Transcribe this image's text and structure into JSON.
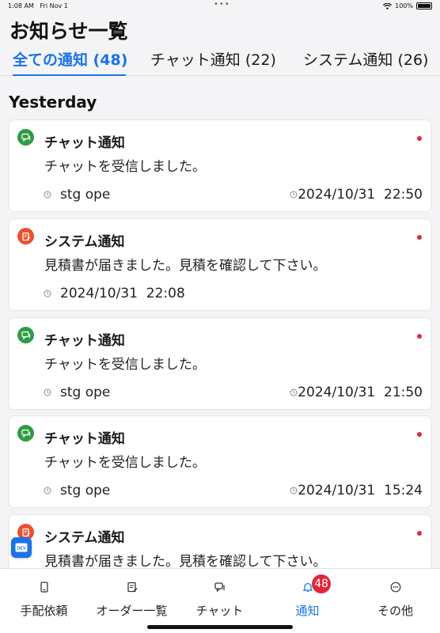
{
  "status_bar": {
    "time": "1:08 AM",
    "date": "Fri Nov 1",
    "battery": "100%"
  },
  "page": {
    "title": "お知らせ一覧"
  },
  "tabs": [
    {
      "label": "全ての通知 (48)",
      "active": true
    },
    {
      "label": "チャット通知 (22)",
      "active": false
    },
    {
      "label": "システム通知 (26)",
      "active": false
    }
  ],
  "section": {
    "header": "Yesterday"
  },
  "notifications": [
    {
      "type": "chat",
      "icon": "chat-bubble-icon",
      "title": "チャット通知",
      "message": "チャットを受信しました。",
      "sender": "stg ope",
      "datetime": "2024/10/31  22:50",
      "unread": true
    },
    {
      "type": "system",
      "icon": "document-edit-icon",
      "title": "システム通知",
      "message": "見積書が届きました。見積を確認して下さい。",
      "sender": "",
      "datetime": "2024/10/31  22:08",
      "unread": true
    },
    {
      "type": "chat",
      "icon": "chat-bubble-icon",
      "title": "チャット通知",
      "message": "チャットを受信しました。",
      "sender": "stg ope",
      "datetime": "2024/10/31  21:50",
      "unread": true
    },
    {
      "type": "chat",
      "icon": "chat-bubble-icon",
      "title": "チャット通知",
      "message": "チャットを受信しました。",
      "sender": "stg ope",
      "datetime": "2024/10/31  15:24",
      "unread": true
    },
    {
      "type": "system",
      "icon": "document-edit-icon",
      "title": "システム通知",
      "message": "見積書が届きました。見積を確認して下さい。",
      "sender": "",
      "datetime": "",
      "unread": true
    }
  ],
  "fab": {
    "label": "DEV"
  },
  "bottom_nav": [
    {
      "label": "手配依頼",
      "icon": "phone-request-icon",
      "active": false
    },
    {
      "label": "オーダー一覧",
      "icon": "order-list-icon",
      "active": false
    },
    {
      "label": "チャット",
      "icon": "chat-icon",
      "active": false
    },
    {
      "label": "通知",
      "icon": "bell-icon",
      "active": true,
      "badge": "48"
    },
    {
      "label": "その他",
      "icon": "more-icon",
      "active": false
    }
  ],
  "colors": {
    "accent": "#1a73e8",
    "chat_green": "#2e9c45",
    "system_orange": "#e8512f",
    "unread_red": "#e0283a"
  }
}
